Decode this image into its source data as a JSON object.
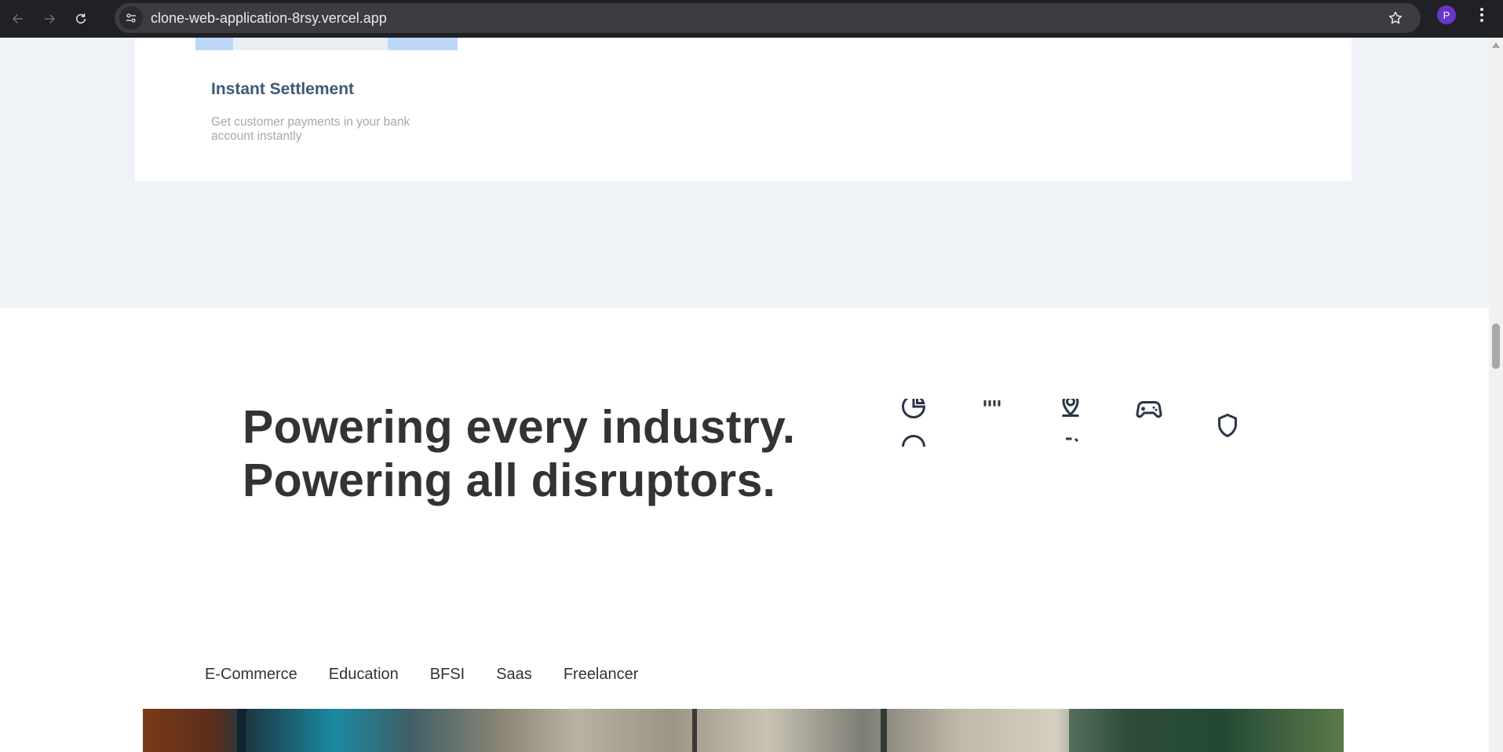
{
  "browser": {
    "url": "clone-web-application-8rsy.vercel.app",
    "profile_initial": "P",
    "icons": {
      "back": "arrow-left-icon",
      "forward": "arrow-right-icon",
      "reload": "reload-icon",
      "site_info": "tune-icon",
      "bookmark": "star-icon",
      "menu": "kebab-menu-icon"
    },
    "profile_color": "#6a35c9"
  },
  "feature_card": {
    "title": "Instant Settlement",
    "description": "Get customer payments in your bank account instantly"
  },
  "hero": {
    "line1": "Powering every industry.",
    "line2": "Powering all disruptors."
  },
  "industry_icons": [
    "pie-chart-icon",
    "grid-icon",
    "location-pin-icon",
    "gamepad-icon",
    "shield-icon",
    "circle-icon",
    "partial-icon"
  ],
  "industry_tabs": [
    "E-Commerce",
    "Education",
    "BFSI",
    "Saas",
    "Freelancer"
  ],
  "colors": {
    "card_title": "#3f5875",
    "headline": "#333333",
    "section_bg": "#eff2f7"
  }
}
